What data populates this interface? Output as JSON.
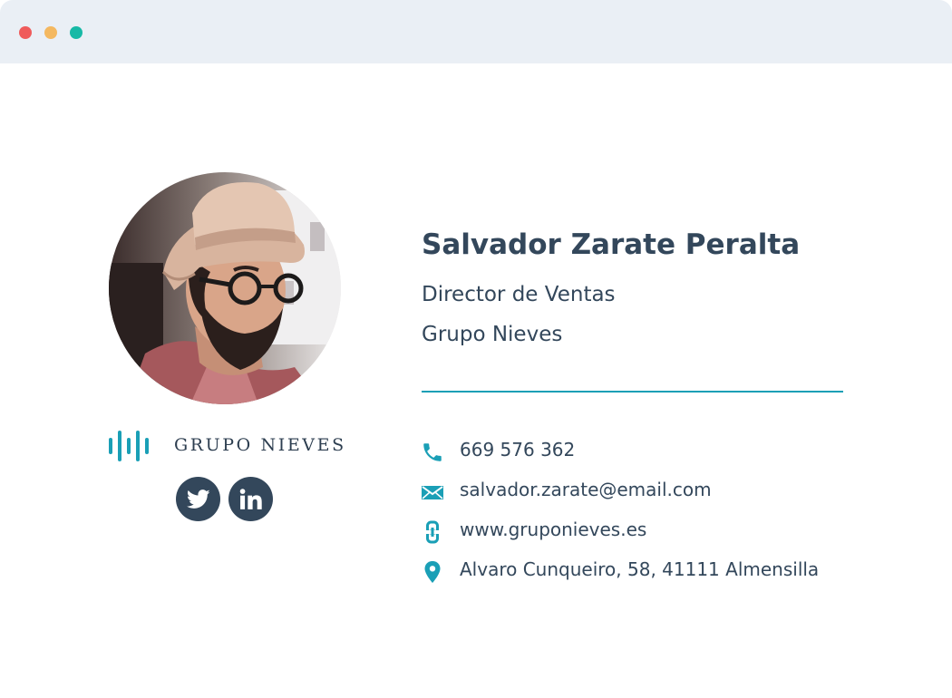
{
  "window": {
    "controls": [
      "close",
      "minimize",
      "maximize"
    ],
    "colors": {
      "close": "#ef5b5b",
      "minimize": "#f4b860",
      "maximize": "#17b9a6"
    }
  },
  "signature": {
    "name": "Salvador Zarate Peralta",
    "title": "Director de Ventas",
    "company": "Grupo Nieves",
    "logo_text": "GRUPO NIEVES",
    "photo": "profile-photo",
    "social": [
      {
        "icon": "twitter-icon"
      },
      {
        "icon": "linkedin-icon"
      }
    ],
    "contacts": {
      "phone": {
        "icon": "phone-icon",
        "value": "669 576 362"
      },
      "email": {
        "icon": "envelope-icon",
        "value": "salvador.zarate@email.com"
      },
      "website": {
        "icon": "link-icon",
        "value": "www.gruponieves.es"
      },
      "address": {
        "icon": "map-pin-icon",
        "value": "Alvaro Cunqueiro, 58, 41111 Almensilla"
      }
    }
  },
  "colors": {
    "accent": "#1a9fb6",
    "text": "#33475b",
    "social_bg": "#33475b",
    "titlebar": "#eaeff5"
  }
}
